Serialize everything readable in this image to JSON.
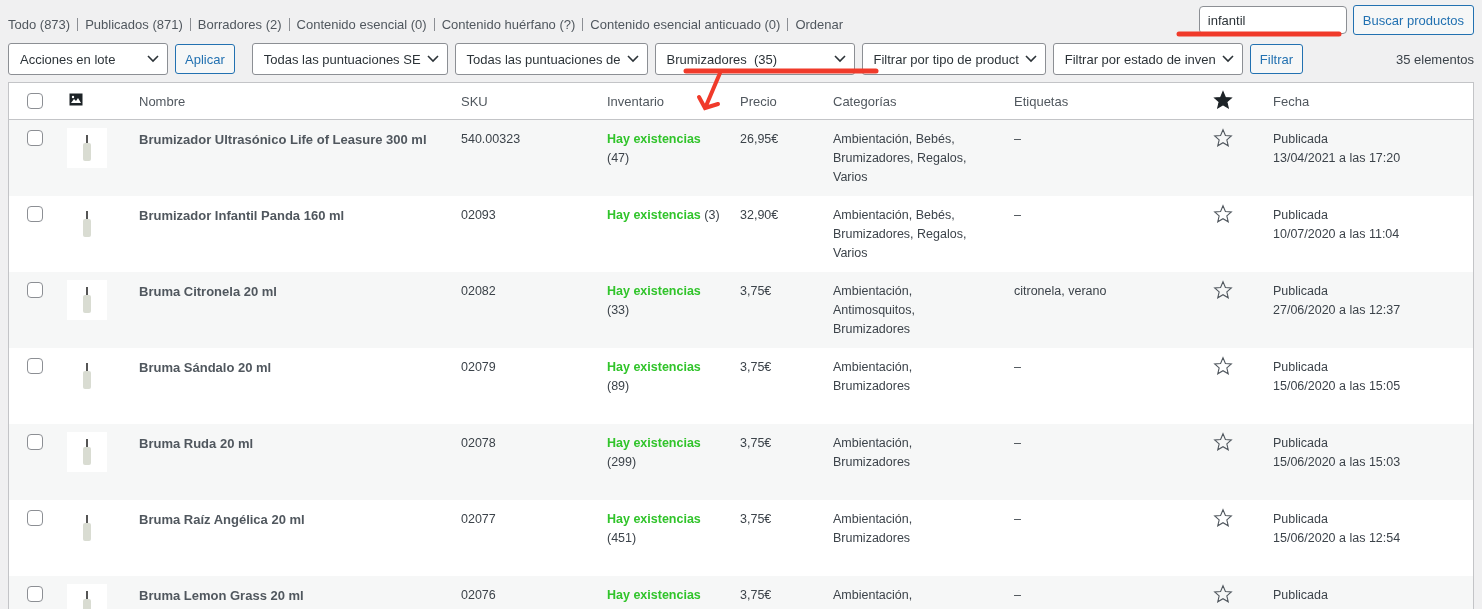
{
  "views": [
    {
      "label": "Todo",
      "count": "(873)"
    },
    {
      "label": "Publicados",
      "count": "(871)"
    },
    {
      "label": "Borradores",
      "count": "(2)"
    },
    {
      "label": "Contenido esencial",
      "count": "(0)"
    },
    {
      "label": "Contenido huérfano",
      "count": "(?)"
    },
    {
      "label": "Contenido esencial anticuado",
      "count": "(0)"
    },
    {
      "label": "Ordenar"
    }
  ],
  "search": {
    "value": "infantil",
    "button": "Buscar productos"
  },
  "bulk": {
    "select": "Acciones en lote",
    "button": "Aplicar"
  },
  "filters": [
    "Todas las puntuaciones SE",
    "Todas las puntuaciones de",
    "Brumizadores  (35)",
    "Filtrar por tipo de product",
    "Filtrar por estado de inven"
  ],
  "filter_button": "Filtrar",
  "item_count": "35 elementos",
  "table": {
    "select_all": {
      "checked": false
    },
    "columns": [
      "Nombre",
      "SKU",
      "Inventario",
      "Precio",
      "Categorías",
      "Etiquetas",
      "Fecha"
    ],
    "rows": [
      {
        "checked": false,
        "name": "Brumizador Ultrasónico Life of Leasure 300 ml",
        "sku": "540.00323",
        "stock": "Hay existencias",
        "stock_count": "(47)",
        "price": "26,95€",
        "categories": "Ambientación, Bebés, Brumizadores, Regalos, Varios",
        "tags": "–",
        "featured": false,
        "status": "Publicada",
        "date": "13/04/2021 a las 17:20"
      },
      {
        "checked": false,
        "name": "Brumizador Infantil Panda 160 ml",
        "sku": "02093",
        "stock": "Hay existencias",
        "stock_count": "(3)",
        "price": "32,90€",
        "categories": "Ambientación, Bebés, Brumizadores, Regalos, Varios",
        "tags": "–",
        "featured": false,
        "status": "Publicada",
        "date": "10/07/2020 a las 11:04"
      },
      {
        "checked": false,
        "name": "Bruma Citronela 20 ml",
        "sku": "02082",
        "stock": "Hay existencias",
        "stock_count": "(33)",
        "price": "3,75€",
        "categories": "Ambientación, Antimosquitos, Brumizadores",
        "tags": "citronela, verano",
        "featured": false,
        "status": "Publicada",
        "date": "27/06/2020 a las 12:37"
      },
      {
        "checked": false,
        "name": "Bruma Sándalo 20 ml",
        "sku": "02079",
        "stock": "Hay existencias",
        "stock_count": "(89)",
        "price": "3,75€",
        "categories": "Ambientación, Brumizadores",
        "tags": "–",
        "featured": false,
        "status": "Publicada",
        "date": "15/06/2020 a las 15:05"
      },
      {
        "checked": false,
        "name": "Bruma Ruda 20 ml",
        "sku": "02078",
        "stock": "Hay existencias",
        "stock_count": "(299)",
        "price": "3,75€",
        "categories": "Ambientación, Brumizadores",
        "tags": "–",
        "featured": false,
        "status": "Publicada",
        "date": "15/06/2020 a las 15:03"
      },
      {
        "checked": false,
        "name": "Bruma Raíz Angélica 20 ml",
        "sku": "02077",
        "stock": "Hay existencias",
        "stock_count": "(451)",
        "price": "3,75€",
        "categories": "Ambientación, Brumizadores",
        "tags": "–",
        "featured": false,
        "status": "Publicada",
        "date": "15/06/2020 a las 12:54"
      },
      {
        "checked": false,
        "name": "Bruma Lemon Grass 20 ml",
        "sku": "02076",
        "stock": "Hay existencias",
        "price": "3,75€",
        "categories": "Ambientación,",
        "tags": "–",
        "featured": false,
        "status": "Publicada"
      }
    ]
  }
}
